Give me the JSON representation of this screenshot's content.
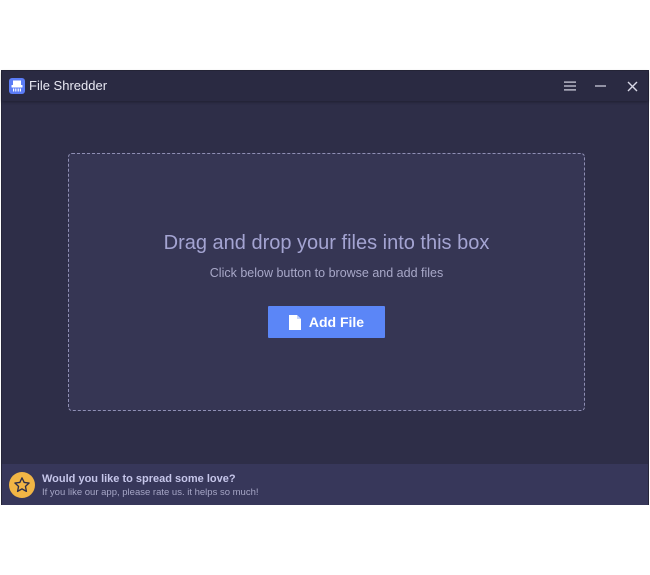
{
  "window": {
    "title": "File Shredder",
    "icon": "shredder-icon",
    "controls": [
      "menu-icon",
      "minimize-icon",
      "close-icon"
    ]
  },
  "dropzone": {
    "title": "Drag and drop your files into this box",
    "subtitle": "Click below button to browse and add files",
    "button_label": "Add File",
    "button_icon": "file-icon"
  },
  "footer": {
    "title": "Would you like to spread some love?",
    "subtitle": "If you like our app, please rate us. it helps so much!",
    "icon": "star-icon"
  },
  "colors": {
    "background": "#2e2e48",
    "dropzone": "#363654",
    "accent": "#5b86f7",
    "star": "#f1b545"
  }
}
